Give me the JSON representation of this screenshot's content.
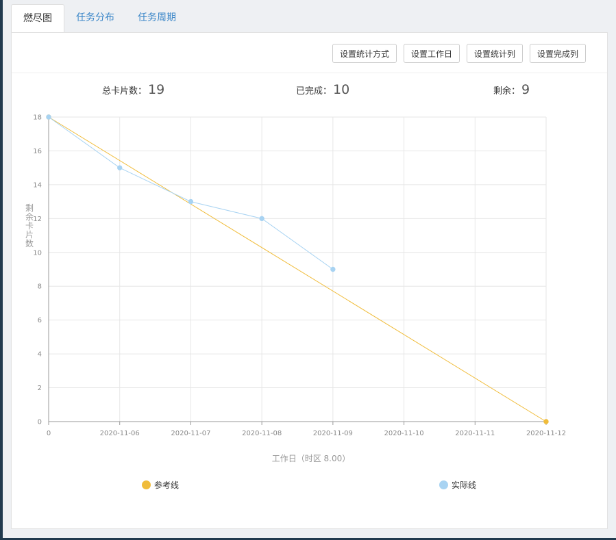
{
  "tabs": [
    {
      "label": "燃尽图",
      "active": true
    },
    {
      "label": "任务分布",
      "active": false
    },
    {
      "label": "任务周期",
      "active": false
    }
  ],
  "toolbar": {
    "stat_method_label": "设置统计方式",
    "workday_label": "设置工作日",
    "stat_column_label": "设置统计列",
    "done_column_label": "设置完成列"
  },
  "stats": {
    "total_label": "总卡片数：",
    "total_value": "19",
    "done_label": "已完成：",
    "done_value": "10",
    "remaining_label": "剩余：",
    "remaining_value": "9"
  },
  "chart_data": {
    "type": "line",
    "categories": [
      "0",
      "2020-11-06",
      "2020-11-07",
      "2020-11-08",
      "2020-11-09",
      "2020-11-10",
      "2020-11-11",
      "2020-11-12"
    ],
    "xlabel": "工作日（时区 8.00）",
    "ylabel": "剩余卡片数",
    "ylim": [
      0,
      18
    ],
    "yticks": [
      0,
      2,
      4,
      6,
      8,
      10,
      12,
      14,
      16,
      18
    ],
    "grid": true,
    "legend_position": "bottom",
    "series": [
      {
        "name": "参考线",
        "color": "#f0bc3a",
        "values": [
          18,
          null,
          null,
          null,
          null,
          null,
          null,
          0
        ],
        "connect": true
      },
      {
        "name": "实际线",
        "color": "#a8d3f2",
        "values": [
          18,
          15,
          13,
          12,
          9,
          null,
          null,
          null
        ],
        "connect": false
      }
    ]
  }
}
